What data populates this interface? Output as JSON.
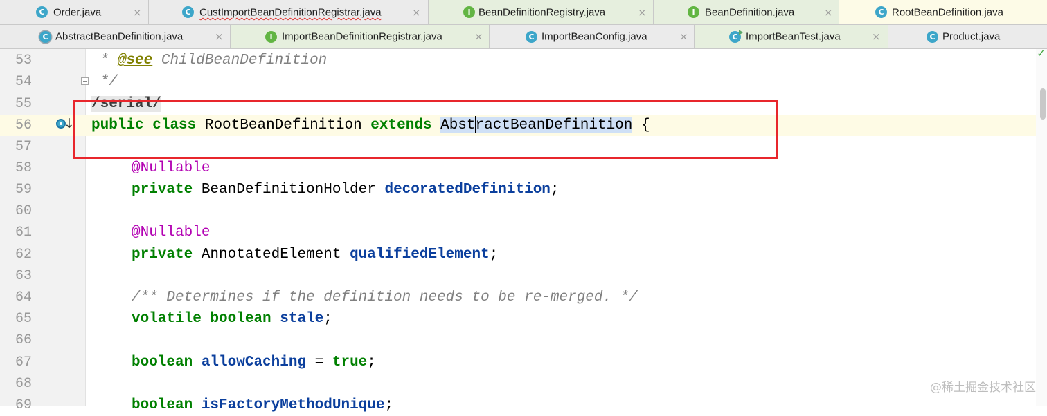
{
  "tabs_row1": [
    {
      "label": "Order.java",
      "icon": "class-icon",
      "active": false
    },
    {
      "label": "CustImportBeanDefinitionRegistrar.java",
      "icon": "class-icon",
      "active": false,
      "error": true
    },
    {
      "label": "BeanDefinitionRegistry.java",
      "icon": "interface-icon",
      "active": false
    },
    {
      "label": "BeanDefinition.java",
      "icon": "interface-icon",
      "active": false
    },
    {
      "label": "RootBeanDefinition.java",
      "icon": "class-icon",
      "active": true
    }
  ],
  "tabs_row2": [
    {
      "label": "AbstractBeanDefinition.java",
      "icon": "abstract-class-icon"
    },
    {
      "label": "ImportBeanDefinitionRegistrar.java",
      "icon": "interface-icon"
    },
    {
      "label": "ImportBeanConfig.java",
      "icon": "class-icon"
    },
    {
      "label": "ImportBeanTest.java",
      "icon": "runnable-class-icon"
    },
    {
      "label": "Product.java",
      "icon": "class-icon"
    }
  ],
  "icon_letters": {
    "class": "C",
    "interface": "I"
  },
  "close_glyph": "×",
  "line_numbers": [
    "53",
    "54",
    "55",
    "56",
    "57",
    "58",
    "59",
    "60",
    "61",
    "62",
    "63",
    "64",
    "65",
    "66",
    "67",
    "68",
    "69"
  ],
  "code": {
    "l53": {
      "star": " * ",
      "tag": "@see",
      "text": " ChildBeanDefinition"
    },
    "l54": {
      "text": " */"
    },
    "l55": {
      "annotation": "/serial/"
    },
    "l56": {
      "kw1": "public",
      "sp1": " ",
      "kw2": "class",
      "name": " RootBeanDefinition ",
      "kw3": "extends",
      "sp2": " ",
      "sel_a": "Abst",
      "sel_b": "ractBeanDefinition",
      "brace": " {"
    },
    "l58": {
      "ann": "@Nullable"
    },
    "l59": {
      "kw": "private",
      "type": " BeanDefinitionHolder ",
      "field": "decoratedDefinition",
      "end": ";"
    },
    "l61": {
      "ann": "@Nullable"
    },
    "l62": {
      "kw": "private",
      "type": " AnnotatedElement ",
      "field": "qualifiedElement",
      "end": ";"
    },
    "l64": {
      "comment": "/** Determines if the definition needs to be re-merged. */"
    },
    "l65": {
      "kw1": "volatile",
      "sp": " ",
      "kw2": "boolean",
      "sp2": " ",
      "field": "stale",
      "end": ";"
    },
    "l67": {
      "kw": "boolean",
      "sp": " ",
      "field": "allowCaching",
      "eq": " = ",
      "val": "true",
      "end": ";"
    },
    "l69": {
      "kw": "boolean",
      "sp": " ",
      "field": "isFactoryMethodUnique",
      "end": ";"
    }
  },
  "status": {
    "check": "✓"
  },
  "gutter": {
    "implements_arrow": "↓"
  },
  "watermark": "@稀土掘金技术社区",
  "colors": {
    "highlight_box": "#e8262c",
    "selection": "#cfe0f6",
    "keyword": "#008000",
    "field": "#0b3f9d",
    "annotation": "#b200b2"
  }
}
